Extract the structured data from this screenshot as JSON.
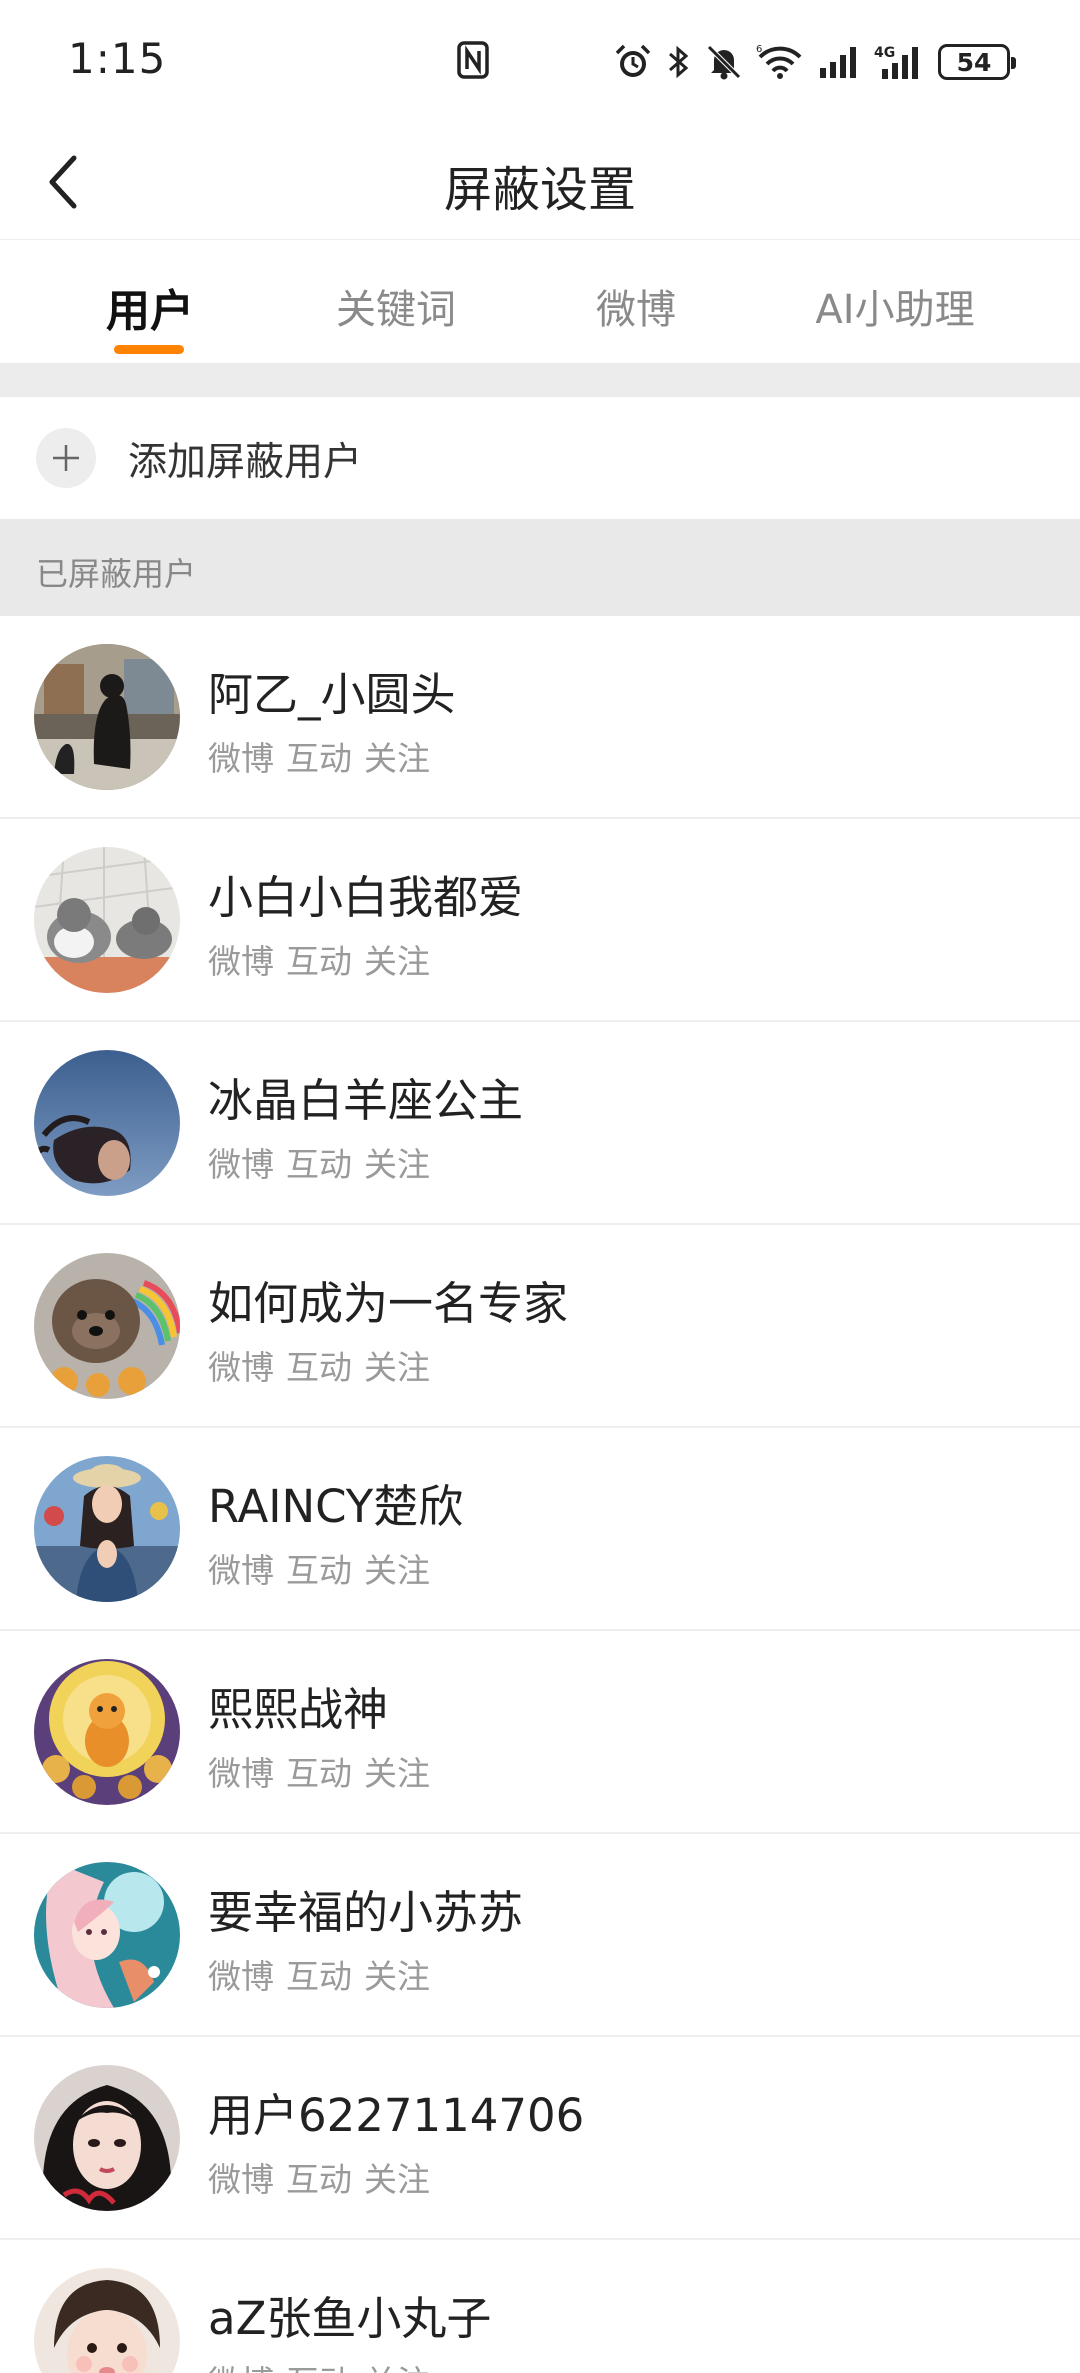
{
  "status_bar": {
    "time": "1:15",
    "battery": "54",
    "icons": [
      "nfc-icon",
      "alarm-icon",
      "bluetooth-icon",
      "bell-off-icon",
      "wifi-icon",
      "signal-icon",
      "signal-4g-icon",
      "battery-icon"
    ]
  },
  "nav": {
    "title": "屏蔽设置",
    "back_icon": "chevron-left-icon"
  },
  "tabs": [
    {
      "label": "用户",
      "active": true
    },
    {
      "label": "关键词",
      "active": false
    },
    {
      "label": "微博",
      "active": false
    },
    {
      "label": "AI小助理",
      "active": false
    }
  ],
  "accent_color": "#ff8200",
  "add_row": {
    "label": "添加屏蔽用户",
    "icon": "plus-icon"
  },
  "section": {
    "title": "已屏蔽用户"
  },
  "users": [
    {
      "name": "阿乙_小圆头",
      "tags": [
        "微博",
        "互动",
        "关注"
      ]
    },
    {
      "name": "小白小白我都爱",
      "tags": [
        "微博",
        "互动",
        "关注"
      ]
    },
    {
      "name": "冰晶白羊座公主",
      "tags": [
        "微博",
        "互动",
        "关注"
      ]
    },
    {
      "name": "如何成为一名专家",
      "tags": [
        "微博",
        "互动",
        "关注"
      ]
    },
    {
      "name": "RAINCY楚欣",
      "tags": [
        "微博",
        "互动",
        "关注"
      ]
    },
    {
      "name": "熙熙战神",
      "tags": [
        "微博",
        "互动",
        "关注"
      ]
    },
    {
      "name": "要幸福的小苏苏",
      "tags": [
        "微博",
        "互动",
        "关注"
      ]
    },
    {
      "name": "用户6227114706",
      "tags": [
        "微博",
        "互动",
        "关注"
      ]
    },
    {
      "name": "aZ张鱼小丸子",
      "tags": [
        "微博",
        "互动",
        "关注"
      ]
    }
  ]
}
